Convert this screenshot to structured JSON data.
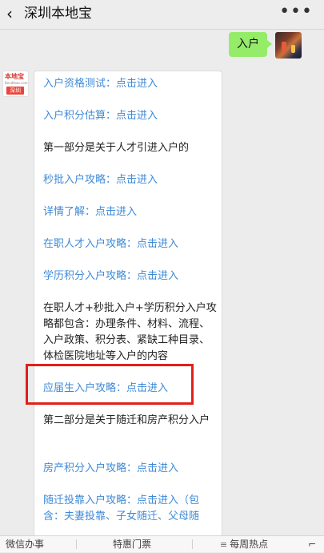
{
  "header": {
    "back_glyph": "‹",
    "title": "深圳本地宝",
    "more_glyph": "•••"
  },
  "outgoing": {
    "text": "入户"
  },
  "bot_avatar": {
    "brand": "本地宝",
    "site": "Bendibao.com",
    "tag": "深圳"
  },
  "message": {
    "lines": [
      "入户资格测试：点击进入",
      "入户积分估算：点击进入",
      "第一部分是关于人才引进入户的",
      "秒批入户攻略：点击进入",
      "详情了解：点击进入",
      "在职人才入户攻略：点击进入",
      "学历积分入户攻略：点击进入",
      "在职人才+秒批入户+学历积分入户攻略都包含：办理条件、材料、流程、入户政策、积分表、紧缺工种目录、体检医院地址等入户的内容",
      "应届生入户攻略：点击进入",
      "第二部分是关于随迁和房产积分入户",
      "房产积分入户攻略：点击进入",
      "随迁投靠入户攻略：点击进入（包含：夫妻投靠、子女随迁、父母随"
    ]
  },
  "menu": {
    "items": [
      "微信办事",
      "特惠门票",
      "每周热点"
    ],
    "hot_icon": "≡",
    "right_glyph": "⌐"
  },
  "colors": {
    "link": "#3e8ad8",
    "outgoing_bubble": "#95ec69",
    "highlight": "#e0201a"
  }
}
